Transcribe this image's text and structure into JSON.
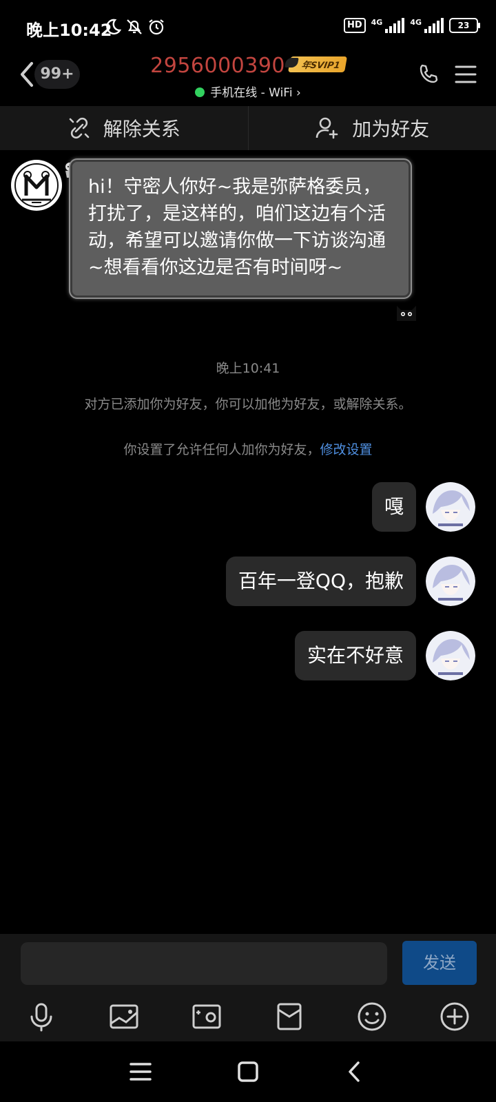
{
  "status_bar": {
    "time": "晚上10:42",
    "icons": [
      "moon-icon",
      "bell-off-icon",
      "alarm-icon"
    ],
    "hd_label": "HD",
    "network_1": "4G",
    "network_2": "4G",
    "battery": "23"
  },
  "header": {
    "unread_count": "99+",
    "contact_name": "2956000390",
    "vip_badge": "年SVIP1",
    "presence": "手机在线 - WiFi",
    "presence_chevron": "›"
  },
  "actions": {
    "remove_relation": "解除关系",
    "add_friend": "加为好友"
  },
  "messages": {
    "incoming_text": "hi！守密人你好~我是弥萨格委员，打扰了，是这样的，咱们这边有个活动，希望可以邀请你做一下访谈沟通~想看看你这边是否有时间呀~",
    "timestamp": "晚上10:41",
    "system_notice": "对方已添加你为好友，你可以加他为好友，或解除关系。",
    "privacy_notice": "你设置了允许任何人加你为好友，",
    "privacy_link": "修改设置",
    "outgoing": [
      "嘎",
      "百年一登QQ，抱歉",
      "实在不好意"
    ]
  },
  "input": {
    "value": "",
    "send_label": "发送"
  },
  "toolbar_icons": [
    "microphone-icon",
    "image-icon",
    "camera-icon",
    "red-packet-icon",
    "emoji-icon",
    "plus-icon"
  ],
  "colors": {
    "contact_name": "#c2453f",
    "online_dot": "#32d15f",
    "link": "#4f8fe0",
    "send_button": "#0f4a88",
    "svip_gold": "#f3c152"
  }
}
